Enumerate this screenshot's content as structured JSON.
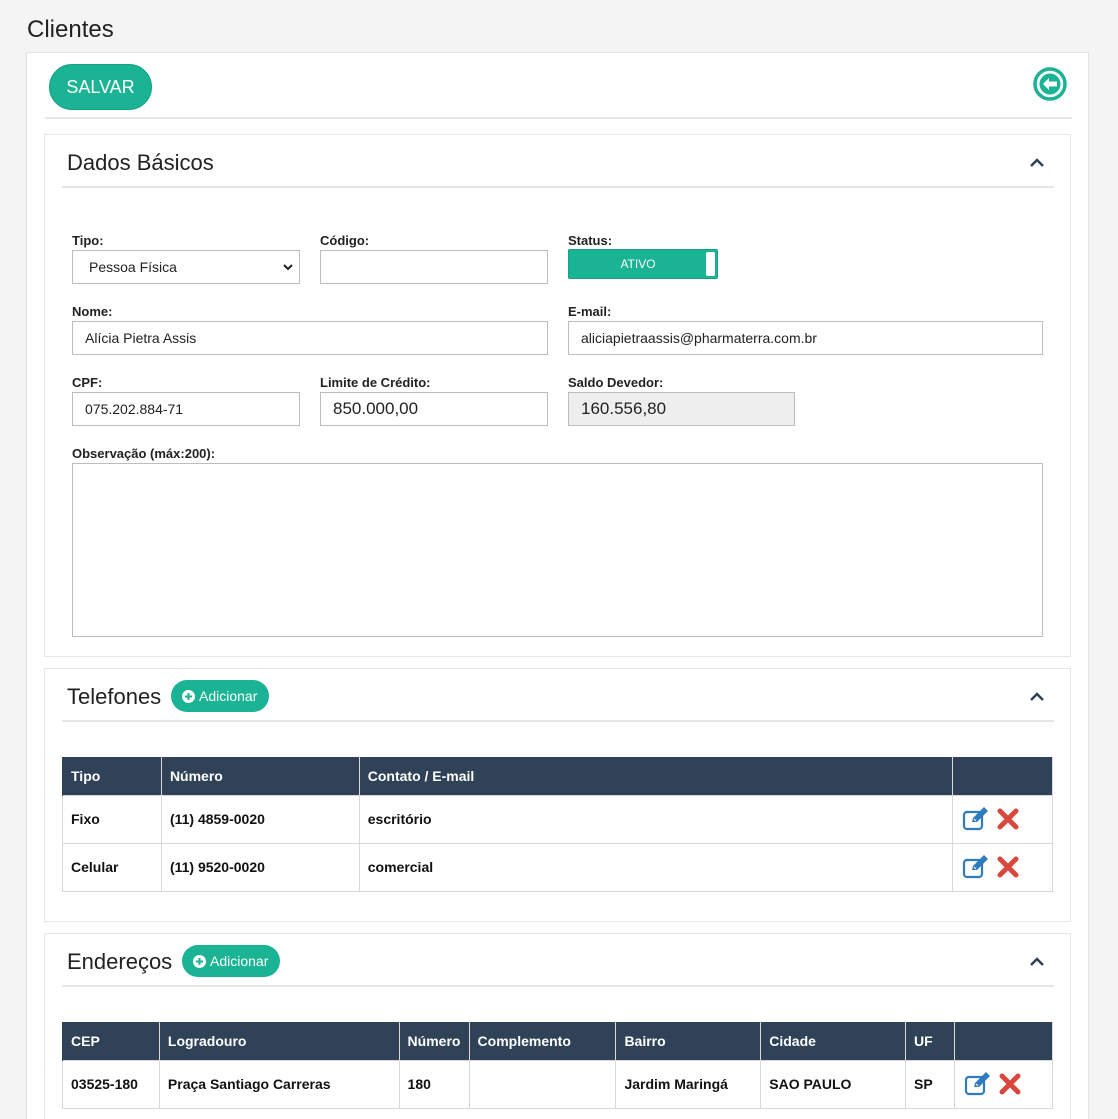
{
  "page": {
    "title": "Clientes"
  },
  "toolbar": {
    "save_label": "SALVAR",
    "back_icon": "arrow-circle-left-icon"
  },
  "colors": {
    "primary": "#1ab394",
    "table_header": "#2f4258",
    "danger": "#d9463b",
    "edit": "#2e7bbf"
  },
  "dados_basicos": {
    "title": "Dados Básicos",
    "tipo": {
      "label": "Tipo:",
      "value": "Pessoa Física"
    },
    "codigo": {
      "label": "Código:",
      "value": ""
    },
    "status": {
      "label": "Status:",
      "value": "ATIVO"
    },
    "nome": {
      "label": "Nome:",
      "value": "Alícia Pietra Assis"
    },
    "email": {
      "label": "E-mail:",
      "value": "aliciapietraassis@pharmaterra.com.br"
    },
    "cpf": {
      "label": "CPF:",
      "value": "075.202.884-71"
    },
    "limite": {
      "label": "Limite de Crédito:",
      "value": "850.000,00"
    },
    "saldo": {
      "label": "Saldo Devedor:",
      "value": "160.556,80"
    },
    "observacao": {
      "label": "Observação (máx:200):",
      "value": ""
    }
  },
  "telefones": {
    "title": "Telefones",
    "add_label": "Adicionar",
    "columns": [
      "Tipo",
      "Número",
      "Contato / E-mail",
      ""
    ],
    "rows": [
      {
        "tipo": "Fixo",
        "numero": "(11) 4859-0020",
        "contato": "escritório"
      },
      {
        "tipo": "Celular",
        "numero": "(11) 9520-0020",
        "contato": "comercial"
      }
    ]
  },
  "enderecos": {
    "title": "Endereços",
    "add_label": "Adicionar",
    "columns": [
      "CEP",
      "Logradouro",
      "Número",
      "Complemento",
      "Bairro",
      "Cidade",
      "UF",
      ""
    ],
    "rows": [
      {
        "cep": "03525-180",
        "logradouro": "Praça Santiago Carreras",
        "numero": "180",
        "complemento": "",
        "bairro": "Jardim Maringá",
        "cidade": "SAO PAULO",
        "uf": "SP"
      }
    ]
  }
}
